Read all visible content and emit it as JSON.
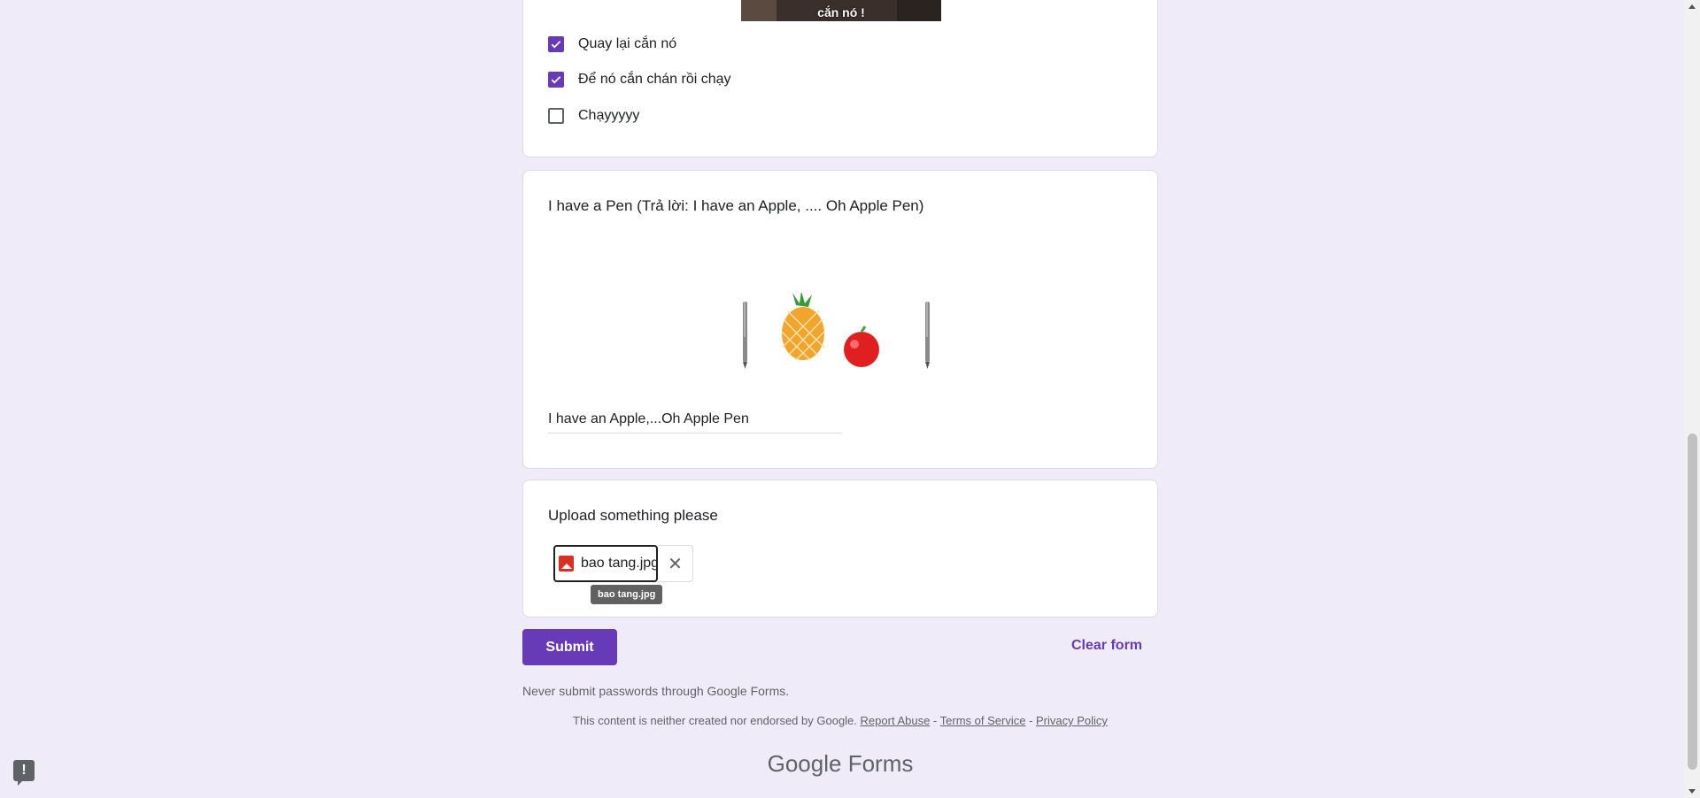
{
  "question_choices": {
    "meme_caption": "cắn nó !",
    "options": [
      {
        "label": "Quay lại cắn nó",
        "checked": true
      },
      {
        "label": "Để nó cắn chán rồi chạy",
        "checked": true
      },
      {
        "label": "Chạyyyyy",
        "checked": false
      }
    ]
  },
  "question_pen": {
    "title": "I have a Pen (Trả lời: I have an Apple, .... Oh Apple Pen)",
    "answer": "I have an Apple,...Oh Apple Pen"
  },
  "question_upload": {
    "title": "Upload something please",
    "file_name": "bao tang.jpg",
    "tooltip": "bao tang.jpg",
    "remove_icon": "close-icon"
  },
  "actions": {
    "submit_label": "Submit",
    "clear_label": "Clear form"
  },
  "footer": {
    "never_submit": "Never submit passwords through Google Forms.",
    "disclaimer": "This content is neither created nor endorsed by Google.",
    "report_abuse": "Report Abuse",
    "sep1": " - ",
    "terms": "Terms of Service",
    "sep2": " - ",
    "privacy": "Privacy Policy",
    "brand_google": "Google",
    "brand_forms": "Forms"
  },
  "colors": {
    "accent": "#673ab7",
    "background": "#f0ebf8"
  }
}
